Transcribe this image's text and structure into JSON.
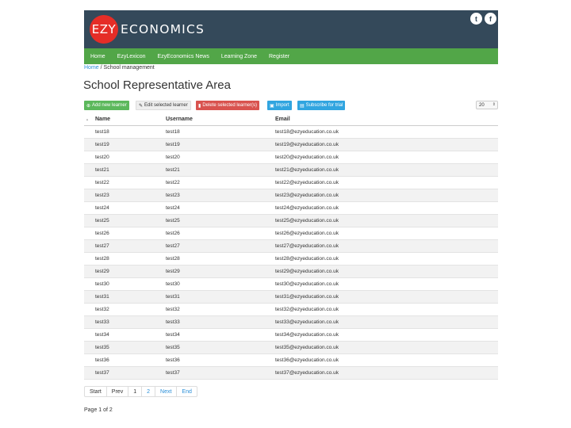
{
  "header": {
    "logo_mark": "EZY",
    "logo_text": "ECONOMICS",
    "twitter_glyph": "t",
    "facebook_glyph": "f"
  },
  "nav": [
    "Home",
    "EzyLexicon",
    "EzyEconomics News",
    "Learning Zone",
    "Register"
  ],
  "breadcrumb": {
    "home": "Home",
    "sep": "/",
    "current": "School management"
  },
  "page_title": "School Representative Area",
  "toolbar": {
    "add": "Add new learner",
    "edit": "Edit selected learner",
    "delete": "Delete selected learner(s)",
    "import": "Import",
    "subscribe": "Subscribe for trial",
    "page_size": "20"
  },
  "table": {
    "headers": [
      "Name",
      "Username",
      "Email"
    ],
    "rows": [
      [
        "test18",
        "test18",
        "test18@ezyeducation.co.uk"
      ],
      [
        "test19",
        "test19",
        "test19@ezyeducation.co.uk"
      ],
      [
        "test20",
        "test20",
        "test20@ezyeducation.co.uk"
      ],
      [
        "test21",
        "test21",
        "test21@ezyeducation.co.uk"
      ],
      [
        "test22",
        "test22",
        "test22@ezyeducation.co.uk"
      ],
      [
        "test23",
        "test23",
        "test23@ezyeducation.co.uk"
      ],
      [
        "test24",
        "test24",
        "test24@ezyeducation.co.uk"
      ],
      [
        "test25",
        "test25",
        "test25@ezyeducation.co.uk"
      ],
      [
        "test26",
        "test26",
        "test26@ezyeducation.co.uk"
      ],
      [
        "test27",
        "test27",
        "test27@ezyeducation.co.uk"
      ],
      [
        "test28",
        "test28",
        "test28@ezyeducation.co.uk"
      ],
      [
        "test29",
        "test29",
        "test29@ezyeducation.co.uk"
      ],
      [
        "test30",
        "test30",
        "test30@ezyeducation.co.uk"
      ],
      [
        "test31",
        "test31",
        "test31@ezyeducation.co.uk"
      ],
      [
        "test32",
        "test32",
        "test32@ezyeducation.co.uk"
      ],
      [
        "test33",
        "test33",
        "test33@ezyeducation.co.uk"
      ],
      [
        "test34",
        "test34",
        "test34@ezyeducation.co.uk"
      ],
      [
        "test35",
        "test35",
        "test35@ezyeducation.co.uk"
      ],
      [
        "test36",
        "test36",
        "test36@ezyeducation.co.uk"
      ],
      [
        "test37",
        "test37",
        "test37@ezyeducation.co.uk"
      ]
    ]
  },
  "pager": [
    "Start",
    "Prev",
    "1",
    "2",
    "Next",
    "End"
  ],
  "page_info": "Page 1 of 2",
  "colors": {
    "header_bg": "#34495a",
    "nav_bg": "#52a648",
    "logo_red": "#e52d27"
  }
}
